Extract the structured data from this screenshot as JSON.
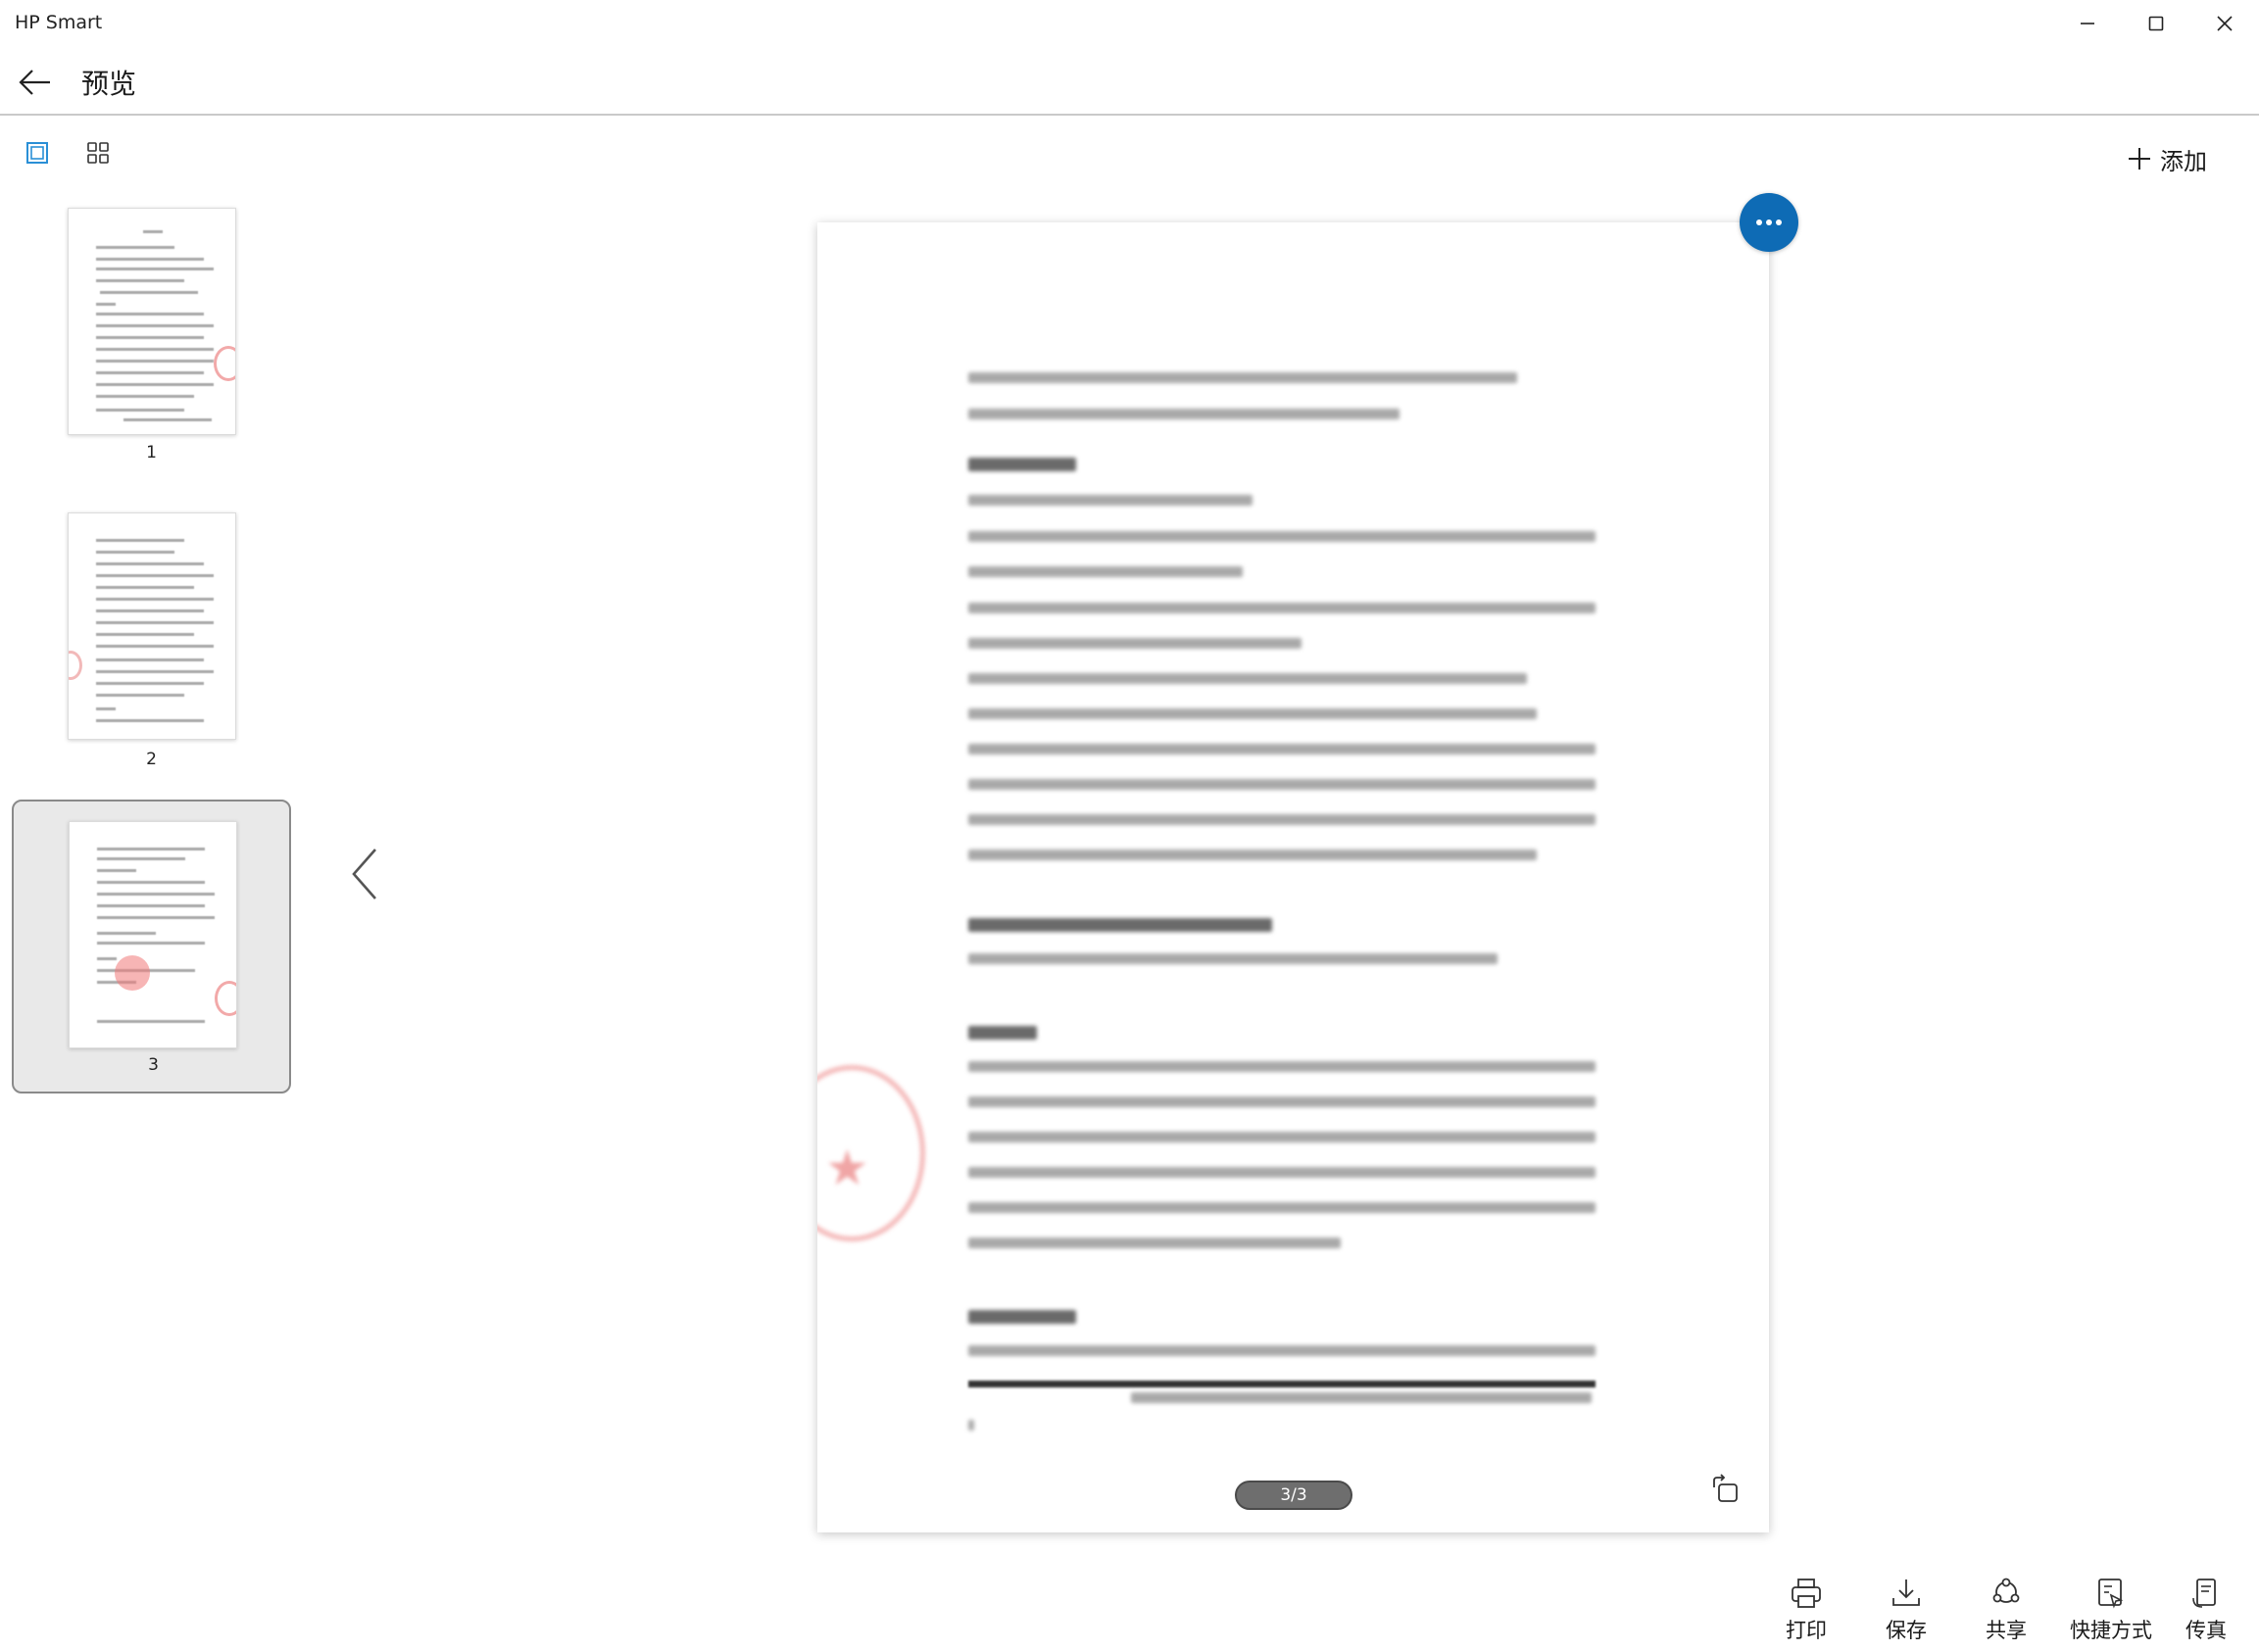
{
  "window": {
    "app_title": "HP Smart"
  },
  "header": {
    "title": "预览"
  },
  "toolbar_top": {
    "add_label": "添加"
  },
  "thumbnails": [
    {
      "number": "1",
      "selected": false
    },
    {
      "number": "2",
      "selected": false
    },
    {
      "number": "3",
      "selected": true
    }
  ],
  "preview": {
    "page_counter": "3/3",
    "current_page": 3,
    "total_pages": 3
  },
  "actions": {
    "print": "打印",
    "save": "保存",
    "share": "共享",
    "shortcut": "快捷方式",
    "fax": "传真"
  },
  "colors": {
    "accent": "#0e6bb5",
    "selected_bg": "#e9e9e9",
    "view_toggle_active": "#2a8fd6"
  }
}
